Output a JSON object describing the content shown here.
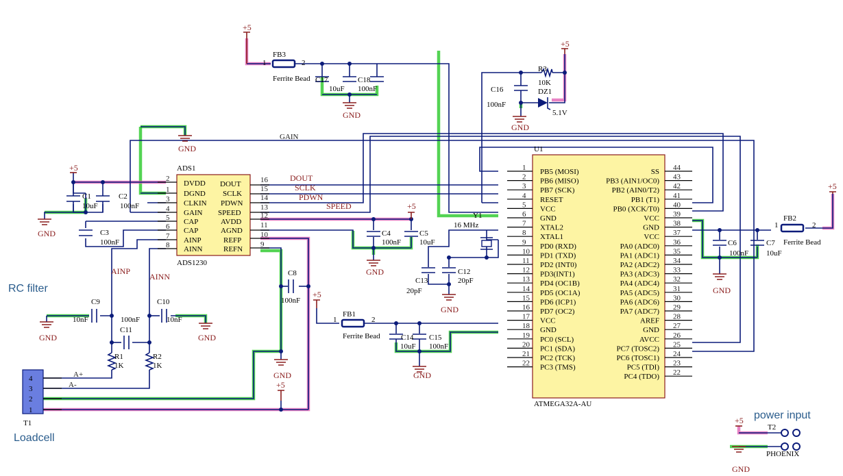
{
  "power": {
    "vcc": "+5",
    "gnd": "GND"
  },
  "ads1230": {
    "ref": "ADS1",
    "part": "ADS1230",
    "left_pins": [
      {
        "num": "2",
        "name": "DVDD"
      },
      {
        "num": "1",
        "name": "DGND"
      },
      {
        "num": "3",
        "name": "CLKIN"
      },
      {
        "num": "4",
        "name": "GAIN"
      },
      {
        "num": "5",
        "name": "CAP"
      },
      {
        "num": "6",
        "name": "CAP"
      },
      {
        "num": "7",
        "name": "AINP"
      },
      {
        "num": "8",
        "name": "AINN"
      }
    ],
    "right_pins": [
      {
        "num": "16",
        "name": "DOUT"
      },
      {
        "num": "15",
        "name": "SCLK"
      },
      {
        "num": "14",
        "name": "PDWN"
      },
      {
        "num": "13",
        "name": "SPEED"
      },
      {
        "num": "12",
        "name": "AVDD"
      },
      {
        "num": "11",
        "name": "AGND"
      },
      {
        "num": "10",
        "name": "REFP"
      },
      {
        "num": "9",
        "name": "REFN"
      }
    ]
  },
  "atmega": {
    "ref": "U1",
    "part": "ATMEGA32A-AU",
    "left_pins": [
      {
        "num": "1",
        "name": "PB5 (MOSI)"
      },
      {
        "num": "2",
        "name": "PB6 (MISO)"
      },
      {
        "num": "3",
        "name": "PB7 (SCK)"
      },
      {
        "num": "4",
        "name": "RESET"
      },
      {
        "num": "5",
        "name": "VCC"
      },
      {
        "num": "6",
        "name": "GND"
      },
      {
        "num": "7",
        "name": "XTAL2"
      },
      {
        "num": "8",
        "name": "XTAL1"
      },
      {
        "num": "9",
        "name": "PD0 (RXD)"
      },
      {
        "num": "10",
        "name": "PD1 (TXD)"
      },
      {
        "num": "11",
        "name": "PD2 (INT0)"
      },
      {
        "num": "12",
        "name": "PD3(INT1)"
      },
      {
        "num": "13",
        "name": "PD4 (OC1B)"
      },
      {
        "num": "14",
        "name": "PD5 (OC1A)"
      },
      {
        "num": "15",
        "name": "PD6 (ICP1)"
      },
      {
        "num": "16",
        "name": "PD7 (OC2)"
      },
      {
        "num": "17",
        "name": "VCC"
      },
      {
        "num": "18",
        "name": "GND"
      },
      {
        "num": "19",
        "name": "PC0 (SCL)"
      },
      {
        "num": "20",
        "name": "PC1 (SDA)"
      },
      {
        "num": "21",
        "name": "PC2 (TCK)"
      },
      {
        "num": "22",
        "name": "PC3 (TMS)"
      }
    ],
    "right_pins": [
      {
        "num": "44",
        "name": "SS"
      },
      {
        "num": "43",
        "name": "PB3 (AIN1/OC0)"
      },
      {
        "num": "42",
        "name": "PB2 (AIN0/T2)"
      },
      {
        "num": "41",
        "name": "PB1 (T1)"
      },
      {
        "num": "40",
        "name": "PB0 (XCK/T0)"
      },
      {
        "num": "39",
        "name": "VCC"
      },
      {
        "num": "38",
        "name": "GND"
      },
      {
        "num": "37",
        "name": "VCC"
      },
      {
        "num": "36",
        "name": "PA0 (ADC0)"
      },
      {
        "num": "35",
        "name": "PA1 (ADC1)"
      },
      {
        "num": "34",
        "name": "PA2 (ADC2)"
      },
      {
        "num": "33",
        "name": "PA3 (ADC3)"
      },
      {
        "num": "32",
        "name": "PA4 (ADC4)"
      },
      {
        "num": "31",
        "name": "PA5 (ADC5)"
      },
      {
        "num": "30",
        "name": "PA6 (ADC6)"
      },
      {
        "num": "29",
        "name": "PA7 (ADC7)"
      },
      {
        "num": "28",
        "name": "AREF"
      },
      {
        "num": "27",
        "name": "GND"
      },
      {
        "num": "26",
        "name": "AVCC"
      },
      {
        "num": "25",
        "name": "PC7 (TOSC2)"
      },
      {
        "num": "24",
        "name": "PC6 (TOSC1)"
      },
      {
        "num": "23",
        "name": "PC5 (TDI)"
      },
      {
        "num": "22b",
        "name": "PC4 (TDO)"
      }
    ]
  },
  "nets": {
    "dout": "DOUT",
    "sclk": "SCLK",
    "pdwn": "PDWN",
    "speed": "SPEED",
    "gain": "GAIN",
    "ainp": "AINP",
    "ainn": "AINN",
    "ap": "A+",
    "am": "A-"
  },
  "parts": {
    "fb1": {
      "ref": "FB1",
      "val": "Ferrite Bead",
      "p1": "1",
      "p2": "2"
    },
    "fb2": {
      "ref": "FB2",
      "val": "Ferrite Bead",
      "p1": "1",
      "p2": "2"
    },
    "fb3": {
      "ref": "FB3",
      "val": "Ferrite Bead",
      "p1": "1",
      "p2": "2"
    },
    "c1": {
      "ref": "C1",
      "val": "10uF"
    },
    "c2": {
      "ref": "C2",
      "val": "100nF"
    },
    "c3": {
      "ref": "C3",
      "val": "100nF"
    },
    "c4": {
      "ref": "C4",
      "val": "100nF"
    },
    "c5": {
      "ref": "C5",
      "val": "10uF"
    },
    "c6": {
      "ref": "C6",
      "val": "100nF"
    },
    "c7": {
      "ref": "C7",
      "val": "10uF"
    },
    "c8": {
      "ref": "C8",
      "val": "100nF"
    },
    "c9": {
      "ref": "C9",
      "val": "10nF"
    },
    "c10": {
      "ref": "C10",
      "val": "10nF"
    },
    "c11": {
      "ref": "C11",
      "val": "100nF"
    },
    "c12": {
      "ref": "C12",
      "val": "20pF"
    },
    "c13": {
      "ref": "C13",
      "val": "20pF"
    },
    "c14": {
      "ref": "C14",
      "val": "10uF"
    },
    "c15": {
      "ref": "C15",
      "val": "100nF"
    },
    "c16": {
      "ref": "C16",
      "val": "100nF"
    },
    "c17": {
      "ref": "C17",
      "val": "10uF"
    },
    "c18": {
      "ref": "C18",
      "val": "100nF"
    },
    "r1": {
      "ref": "R1",
      "val": "1K"
    },
    "r2": {
      "ref": "R2",
      "val": "1K"
    },
    "r3": {
      "ref": "R3",
      "val": "10K"
    },
    "dz1": {
      "ref": "DZ1",
      "val": "5.1V"
    },
    "y1": {
      "ref": "Y1",
      "val": "16 MHz"
    },
    "t1": {
      "ref": "T1",
      "pins": [
        "4",
        "3",
        "2",
        "1"
      ]
    },
    "t2": {
      "ref": "T2",
      "val": "PHOENIX"
    }
  },
  "notes": {
    "rc_filter": "RC filter",
    "loadcell": "Loadcell",
    "power_input": "power input"
  },
  "colors": {
    "wire": "#0b1b7a",
    "highlight_gnd": "#19c419",
    "highlight_vcc": "#e05ab1",
    "ic_fill": "#fdf4a3",
    "power_symbol": "#8a1d1d",
    "annotation_text": "#2a5c8c"
  }
}
